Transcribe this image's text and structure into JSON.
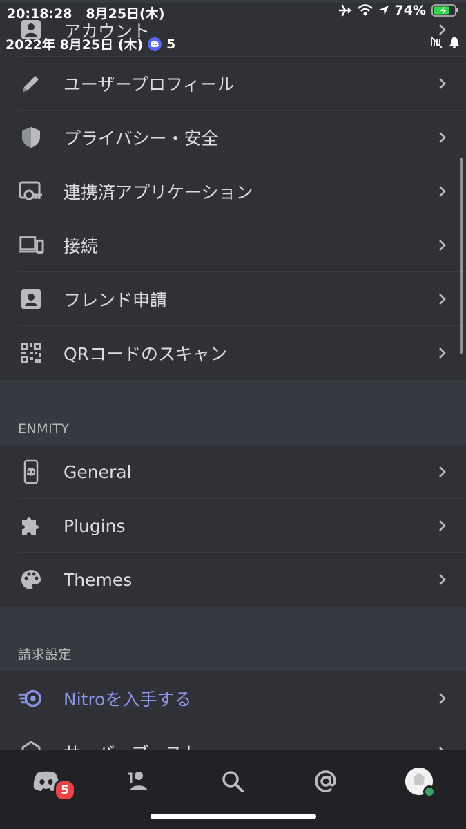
{
  "status_bar": {
    "time": "20:18:28",
    "date": "8月25日(木)",
    "battery": "74%",
    "overlay_date": "2022年 8月25日 (木)",
    "overlay_count": "5"
  },
  "account_section": {
    "items": [
      {
        "label": "アカウント",
        "icon": "person-icon"
      },
      {
        "label": "ユーザープロフィール",
        "icon": "pencil-icon"
      },
      {
        "label": "プライバシー・安全",
        "icon": "shield-icon"
      },
      {
        "label": "連携済アプリケーション",
        "icon": "app-key-icon"
      },
      {
        "label": "接続",
        "icon": "devices-icon"
      },
      {
        "label": "フレンド申請",
        "icon": "contact-card-icon"
      },
      {
        "label": "QRコードのスキャン",
        "icon": "qr-code-icon"
      }
    ]
  },
  "enmity_section": {
    "header": "ENMITY",
    "items": [
      {
        "label": "General",
        "icon": "phone-discord-icon"
      },
      {
        "label": "Plugins",
        "icon": "puzzle-icon"
      },
      {
        "label": "Themes",
        "icon": "palette-icon"
      }
    ]
  },
  "billing_section": {
    "header": "請求設定",
    "items": [
      {
        "label": "Nitroを入手する",
        "icon": "nitro-icon"
      },
      {
        "label": "サーバーブースト",
        "icon": "boost-icon"
      }
    ]
  },
  "tab_bar": {
    "home_badge": "5",
    "tabs": [
      "home-tab",
      "friends-tab",
      "search-tab",
      "mentions-tab",
      "profile-tab"
    ]
  },
  "colors": {
    "background": "#36393f",
    "section": "#2f3136",
    "tabbar": "#202225",
    "nitro_accent": "#8c96e8",
    "badge": "#ed4245",
    "online": "#3ba55d"
  }
}
